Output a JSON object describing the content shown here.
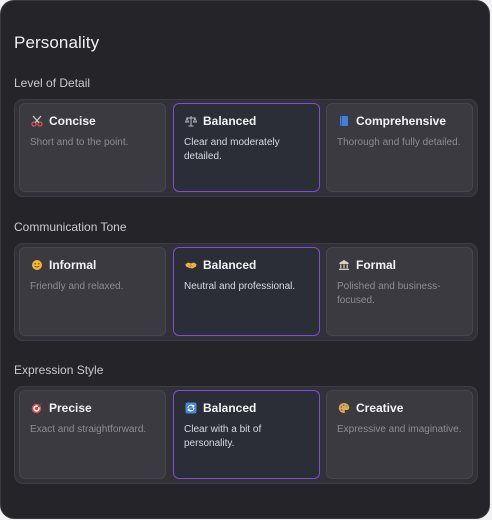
{
  "title": "Personality",
  "sections": [
    {
      "label": "Level of Detail",
      "options": [
        {
          "icon": "scissors-icon",
          "name": "Concise",
          "desc": "Short and to the point.",
          "selected": false
        },
        {
          "icon": "scales-icon",
          "name": "Balanced",
          "desc": "Clear and moderately detailed.",
          "selected": true
        },
        {
          "icon": "book-icon",
          "name": "Comprehensive",
          "desc": "Thorough and fully detailed.",
          "selected": false
        }
      ]
    },
    {
      "label": "Communication Tone",
      "options": [
        {
          "icon": "smile-icon",
          "name": "Informal",
          "desc": "Friendly and relaxed.",
          "selected": false
        },
        {
          "icon": "handshake-icon",
          "name": "Balanced",
          "desc": "Neutral and professional.",
          "selected": true
        },
        {
          "icon": "building-icon",
          "name": "Formal",
          "desc": "Polished and business-focused.",
          "selected": false
        }
      ]
    },
    {
      "label": "Expression Style",
      "options": [
        {
          "icon": "target-icon",
          "name": "Precise",
          "desc": "Exact and straightforward.",
          "selected": false
        },
        {
          "icon": "refresh-icon",
          "name": "Balanced",
          "desc": "Clear with a bit of personality.",
          "selected": true
        },
        {
          "icon": "palette-icon",
          "name": "Creative",
          "desc": "Expressive and imaginative.",
          "selected": false
        }
      ]
    }
  ],
  "colors": {
    "background": "#252529",
    "group": "#313137",
    "card": "#3a3a40",
    "selected_border": "#7b4fd8"
  }
}
